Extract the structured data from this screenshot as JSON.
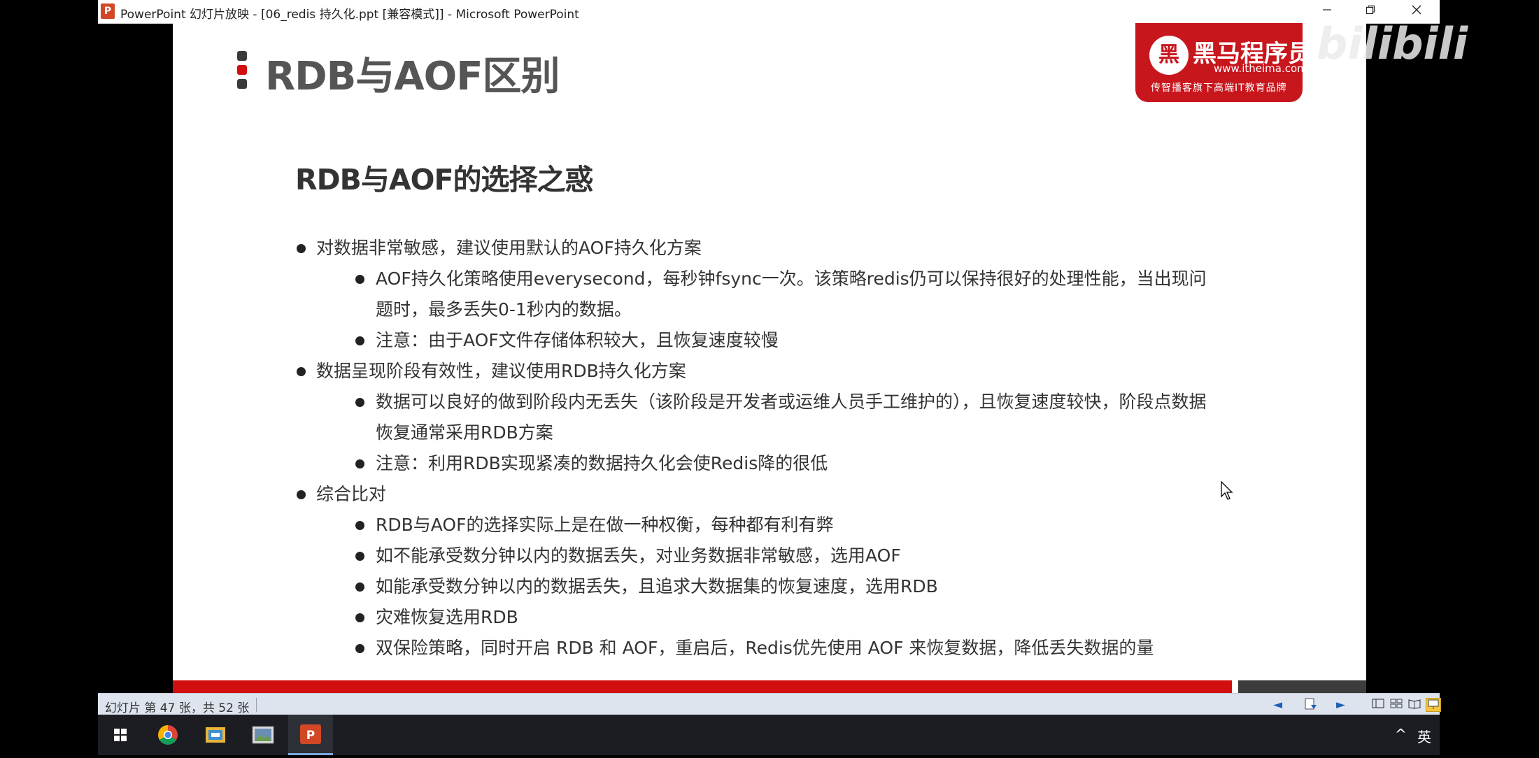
{
  "window": {
    "app_icon": "P",
    "title": "PowerPoint 幻灯片放映 - [06_redis 持久化.ppt [兼容模式]] - Microsoft PowerPoint",
    "buttons": {
      "minimize": "minimize-icon",
      "restore": "restore-icon",
      "close": "close-icon"
    }
  },
  "slide": {
    "title": "RDB与AOF区别",
    "marker_colors": [
      "#3a3a3a",
      "#d10f0f",
      "#3a3a3a"
    ],
    "subtitle": "RDB与AOF的选择之惑",
    "logo": {
      "name": "黑马程序员",
      "mark": "黑",
      "url": "www.itheima.com",
      "slogan": "传智播客旗下高端IT教育品牌"
    },
    "bullets": [
      {
        "level": 1,
        "text": "对数据非常敏感，建议使用默认的AOF持久化方案"
      },
      {
        "level": 2,
        "text": "AOF持久化策略使用everysecond，每秒钟fsync一次。该策略redis仍可以保持很好的处理性能，当出现问题时，最多丢失0-1秒内的数据。"
      },
      {
        "level": 2,
        "text": "注意：由于AOF文件存储体积较大，且恢复速度较慢"
      },
      {
        "level": 1,
        "text": "数据呈现阶段有效性，建议使用RDB持久化方案"
      },
      {
        "level": 2,
        "text": "数据可以良好的做到阶段内无丢失（该阶段是开发者或运维人员手工维护的），且恢复速度较快，阶段点数据恢复通常采用RDB方案"
      },
      {
        "level": 2,
        "text": "注意：利用RDB实现紧凑的数据持久化会使Redis降的很低"
      },
      {
        "level": 1,
        "text": "综合比对"
      },
      {
        "level": 2,
        "text": "RDB与AOF的选择实际上是在做一种权衡，每种都有利有弊"
      },
      {
        "level": 2,
        "text": "如不能承受数分钟以内的数据丢失，对业务数据非常敏感，选用AOF"
      },
      {
        "level": 2,
        "text": "如能承受数分钟以内的数据丢失，且追求大数据集的恢复速度，选用RDB"
      },
      {
        "level": 2,
        "text": "灾难恢复选用RDB"
      },
      {
        "level": 2,
        "text": "双保险策略，同时开启 RDB 和 AOF，重启后，Redis优先使用 AOF 来恢复数据，降低丢失数据的量"
      }
    ]
  },
  "watermark": "bilibili",
  "statusbar": {
    "slide_info": "幻灯片 第 47 张，共 52 张",
    "nav_prev": "◄",
    "nav_menu": "slide-menu-icon",
    "nav_next": "►",
    "views": [
      "normal-view-icon",
      "slide-sorter-icon",
      "reading-view-icon",
      "slideshow-icon"
    ]
  },
  "taskbar": {
    "items": [
      "start-icon",
      "chrome-icon",
      "file-explorer-icon",
      "image-viewer-icon",
      "powerpoint-icon"
    ],
    "tray_chevron": "^",
    "ime": "英"
  },
  "colors": {
    "accent_red": "#d10f0f",
    "title_gray": "#555555",
    "logo_red": "#c8161d"
  }
}
